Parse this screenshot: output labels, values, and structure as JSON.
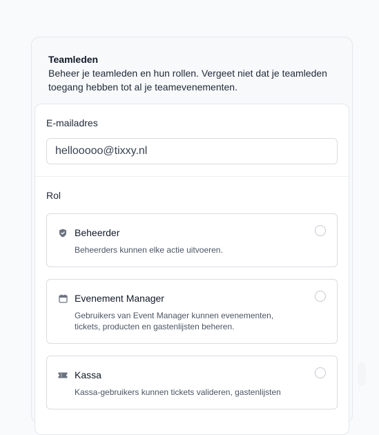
{
  "team": {
    "title": "Teamleden",
    "description_line1": "Beheer je teamleden en hun rollen. Vergeet niet dat je teamleden",
    "description_line2": "toegang hebben tot al je teamevenementen."
  },
  "form": {
    "email_label": "E-mailadres",
    "email_value": "hellooooo@tixxy.nl",
    "role_label": "Rol",
    "roles": [
      {
        "icon": "shield-icon",
        "title": "Beheerder",
        "desc_line1": "Beheerders kunnen elke actie uitvoeren.",
        "desc_line2": "",
        "selected": false
      },
      {
        "icon": "calendar-icon",
        "title": "Evenement Manager",
        "desc_line1": "Gebruikers van Event Manager kunnen evenementen,",
        "desc_line2": "tickets, producten en gastenlijsten beheren.",
        "selected": false
      },
      {
        "icon": "ticket-icon",
        "title": "Kassa",
        "desc_line1": "Kassa-gebruikers kunnen tickets valideren, gastenlijsten",
        "desc_line2": "",
        "selected": false
      }
    ]
  }
}
